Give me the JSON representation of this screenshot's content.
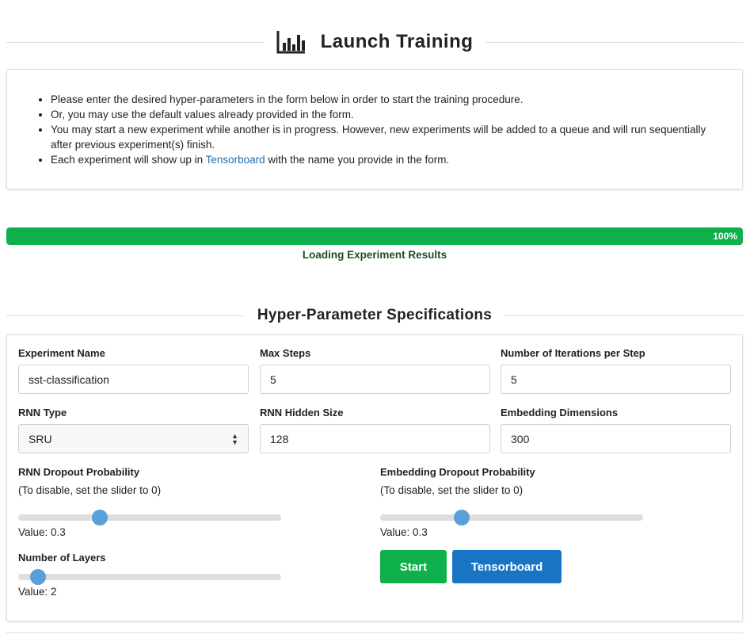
{
  "header": {
    "title": "Launch Training",
    "icon": "bar-chart-icon"
  },
  "info": {
    "items": [
      {
        "text": "Please enter the desired hyper-parameters in the form below in order to start the training procedure."
      },
      {
        "text": "Or, you may use the default values already provided in the form."
      },
      {
        "text": "You may start a new experiment while another is in progress. However, new experiments will be added to a queue and will run sequentially after previous experiment(s) finish."
      },
      {
        "prefix": "Each experiment will show up in ",
        "link": "Tensorboard",
        "suffix": " with the name you provide in the form."
      }
    ]
  },
  "progress": {
    "value": 1.0,
    "percent_label": "100%",
    "status": "Loading Experiment Results",
    "color": "#0db04b"
  },
  "form": {
    "title": "Hyper-Parameter Specifications",
    "experiment_name": {
      "label": "Experiment Name",
      "value": "sst-classification"
    },
    "max_steps": {
      "label": "Max Steps",
      "value": "5"
    },
    "iterations_per_step": {
      "label": "Number of Iterations per Step",
      "value": "5"
    },
    "rnn_type": {
      "label": "RNN Type",
      "value": "SRU"
    },
    "rnn_hidden_size": {
      "label": "RNN Hidden Size",
      "value": "128"
    },
    "embedding_dimensions": {
      "label": "Embedding Dimensions",
      "value": "300"
    },
    "rnn_dropout": {
      "label": "RNN Dropout Probability",
      "hint": "(To disable, set the slider to 0)",
      "value": 0.3,
      "value_text": "Value: 0.3"
    },
    "embedding_dropout": {
      "label": "Embedding Dropout Probability",
      "hint": "(To disable, set the slider to 0)",
      "value": 0.3,
      "value_text": "Value: 0.3"
    },
    "num_layers": {
      "label": "Number of Layers",
      "value": 2,
      "value_text": "Value: 2"
    },
    "buttons": {
      "start": "Start",
      "tensorboard": "Tensorboard"
    }
  },
  "colors": {
    "primary_green": "#0db04b",
    "primary_blue": "#1a74c4",
    "slider_thumb": "#5a9fd8",
    "link": "#1a6fb5"
  }
}
